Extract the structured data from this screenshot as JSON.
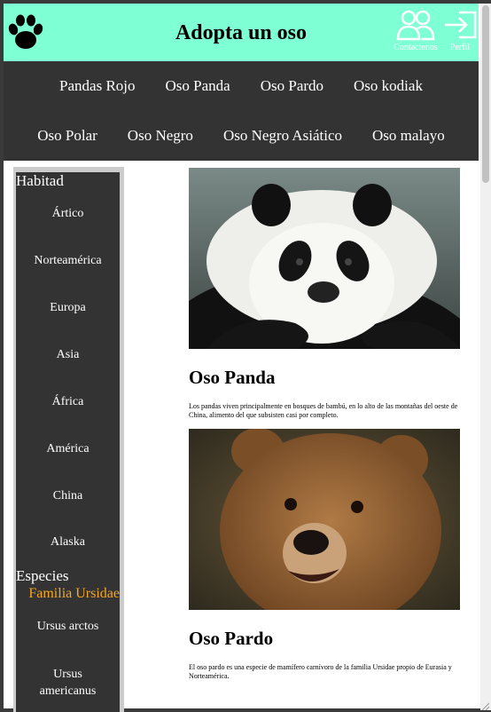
{
  "header": {
    "title": "Adopta un oso",
    "contacts_label": "Contactenos",
    "profile_label": "Perfil"
  },
  "nav": {
    "row1": [
      "Pandas Rojo",
      "Oso Panda",
      "Oso Pardo",
      "Oso kodiak"
    ],
    "row2": [
      "Oso Polar",
      "Oso Negro",
      "Oso Negro Asiático",
      "Oso malayo"
    ]
  },
  "sidebar": {
    "habitat_heading": "Habitad",
    "habitats": [
      "Ártico",
      "Norteamérica",
      "Europa",
      "Asia",
      "África",
      "América",
      "China",
      "Alaska"
    ],
    "species_heading": "Especies",
    "family_label": "Familia Ursidae",
    "species": [
      "Ursus arctos",
      "Ursus americanus"
    ]
  },
  "animals": [
    {
      "name": "Oso Panda",
      "description": "Los pandas viven principalmente en bosques de bambú, en lo alto de las montañas del oeste de China, alimento del que subsisten casi por completo."
    },
    {
      "name": "Oso Pardo",
      "description": "El oso pardo es una especie de mamífero carnívoro de la familia Ursidae propio de Eurasia y Norteamérica."
    }
  ],
  "colors": {
    "header_bg": "#7fffd4",
    "nav_bg": "#333333",
    "accent": "#f5a623"
  },
  "icons": {
    "logo": "paw-icon",
    "contacts": "users-icon",
    "profile": "sign-in-icon"
  }
}
